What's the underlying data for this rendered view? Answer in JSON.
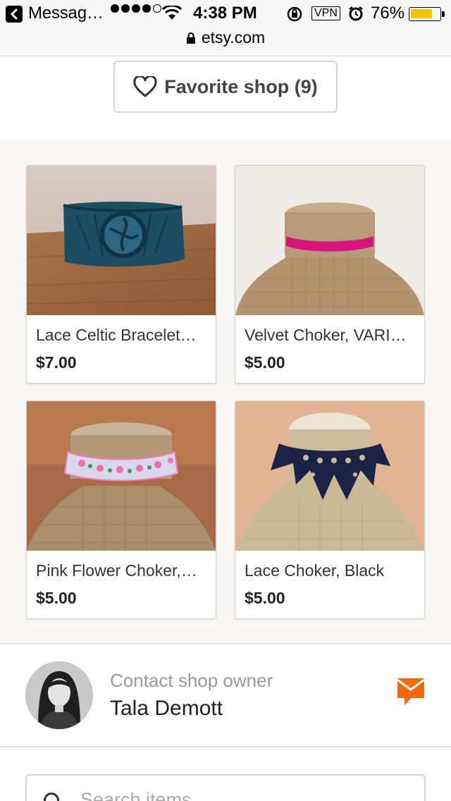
{
  "status_bar": {
    "back_app": "Messag…",
    "time": "4:38 PM",
    "vpn": "VPN",
    "battery_percent": "76%",
    "battery_level": 0.76,
    "battery_color": "#f5c400"
  },
  "browser": {
    "url": "etsy.com"
  },
  "shop": {
    "favorite_label": "Favorite shop (9)"
  },
  "listings": [
    {
      "title": "Lace Celtic Bracelet…",
      "price": "$7.00"
    },
    {
      "title": "Velvet Choker, VARI…",
      "price": "$5.00"
    },
    {
      "title": "Pink Flower Choker,…",
      "price": "$5.00"
    },
    {
      "title": "Lace Choker, Black",
      "price": "$5.00"
    }
  ],
  "contact": {
    "label": "Contact shop owner",
    "owner_name": "Tala Demott",
    "accent_color": "#f26a0f"
  },
  "search": {
    "placeholder": "Search items"
  }
}
